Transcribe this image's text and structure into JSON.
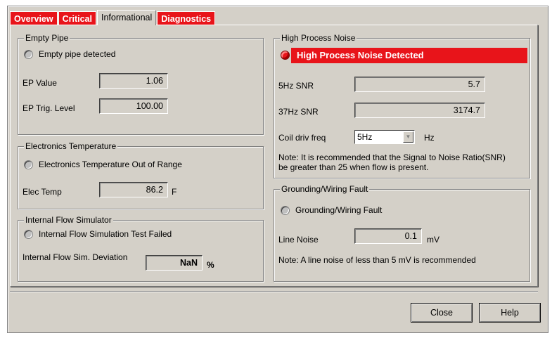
{
  "tabs": [
    "Overview",
    "Critical",
    "Informational",
    "Diagnostics"
  ],
  "empty_pipe": {
    "title": "Empty Pipe",
    "status_label": "Empty pipe detected",
    "ep_value_label": "EP Value",
    "ep_value": "1.06",
    "ep_trig_label": "EP Trig. Level",
    "ep_trig_value": "100.00"
  },
  "electronics_temp": {
    "title": "Electronics Temperature",
    "status_label": "Electronics Temperature Out of Range",
    "elec_temp_label": "Elec Temp",
    "elec_temp_value": "86.2",
    "elec_temp_unit": "F"
  },
  "flow_simulator": {
    "title": "Internal Flow Simulator",
    "status_label": "Internal Flow Simulation Test Failed",
    "deviation_label": "Internal Flow Sim. Deviation",
    "deviation_value": "NaN",
    "deviation_unit": "%"
  },
  "process_noise": {
    "title": "High Process Noise",
    "alert_label": "High Process Noise Detected",
    "snr5_label": "5Hz SNR",
    "snr5_value": "5.7",
    "snr37_label": "37Hz SNR",
    "snr37_value": "3174.7",
    "coil_label": "Coil driv freq",
    "coil_value": "5Hz",
    "coil_unit": "Hz",
    "note_line1": "Note: It is recommended that the Signal to Noise Ratio(SNR)",
    "note_line2": "be greater than 25 when flow is present."
  },
  "grounding": {
    "title": "Grounding/Wiring Fault",
    "status_label": "Grounding/Wiring Fault",
    "line_noise_label": "Line Noise",
    "line_noise_value": "0.1",
    "line_noise_unit": "mV",
    "note": "Note: A line noise of less than 5 mV is recommended"
  },
  "buttons": {
    "close": "Close",
    "help": "Help"
  },
  "colors": {
    "alert_red": "#e8141a",
    "face": "#d4d0c8"
  }
}
